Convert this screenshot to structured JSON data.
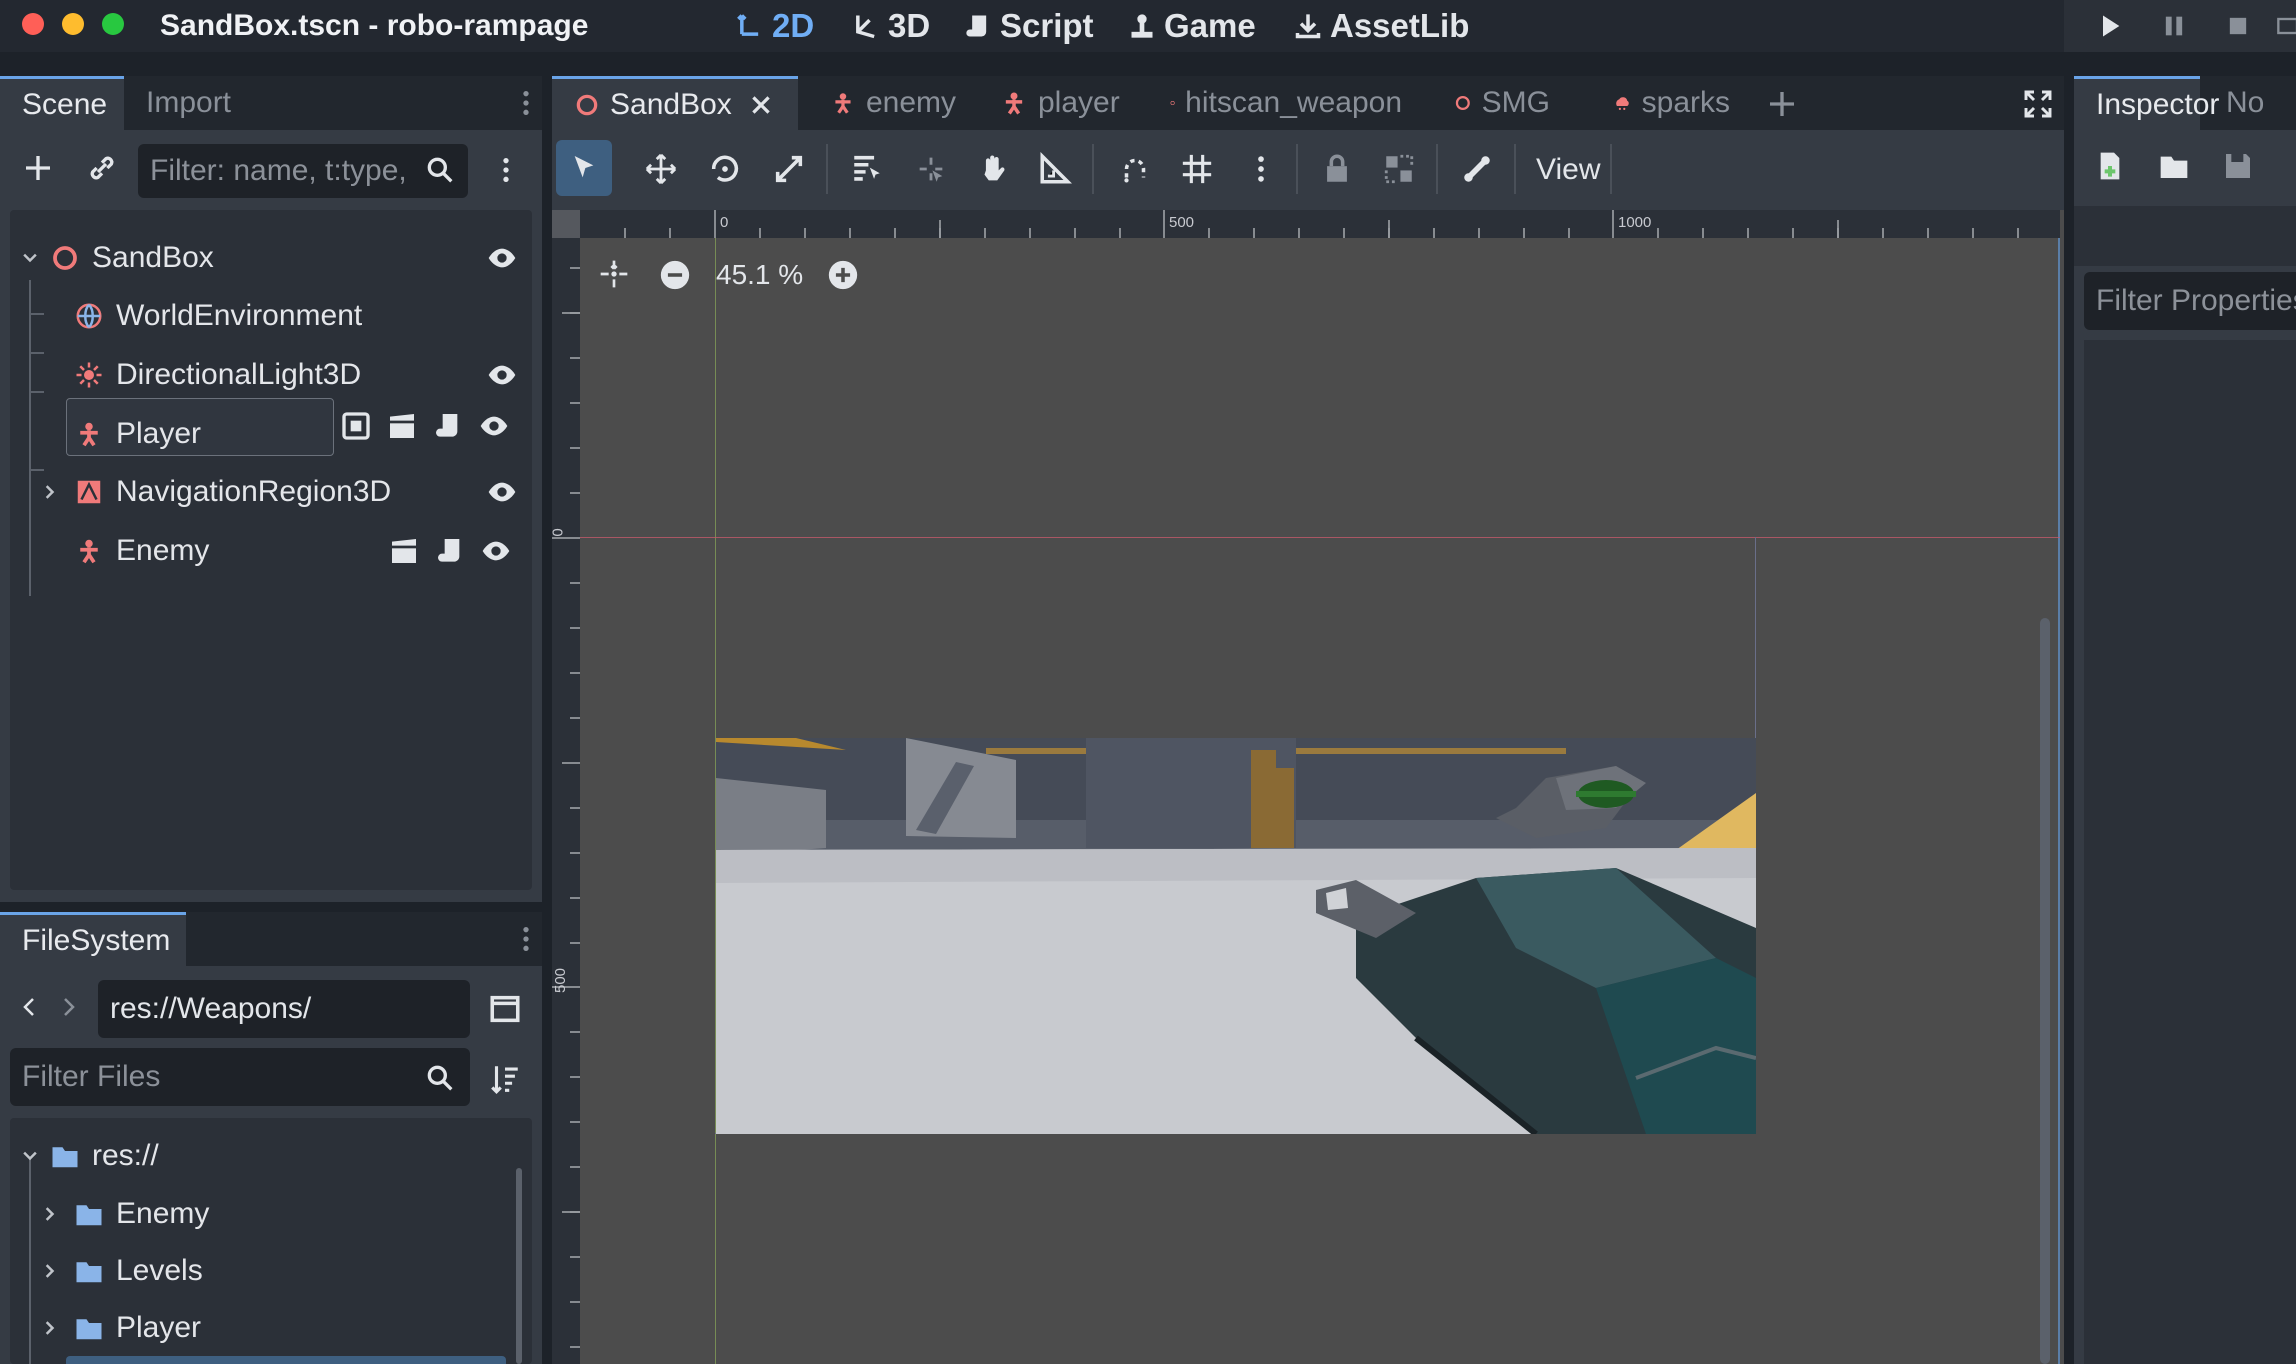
{
  "window": {
    "title": "SandBox.tscn - robo-rampage"
  },
  "workspaces": [
    {
      "label": "2D",
      "icon": "2d-icon",
      "active": true
    },
    {
      "label": "3D",
      "icon": "3d-icon",
      "active": false
    },
    {
      "label": "Script",
      "icon": "script-icon",
      "active": false
    },
    {
      "label": "Game",
      "icon": "game-icon",
      "active": false
    },
    {
      "label": "AssetLib",
      "icon": "assetlib-icon",
      "active": false
    }
  ],
  "scene_dock": {
    "tabs": [
      "Scene",
      "Import"
    ],
    "filter_placeholder": "Filter: name, t:type,",
    "nodes": [
      {
        "label": "SandBox",
        "icon": "node-icon"
      },
      {
        "label": "WorldEnvironment",
        "icon": "world-environment-icon"
      },
      {
        "label": "DirectionalLight3D",
        "icon": "light-icon"
      },
      {
        "label": "Player",
        "icon": "character-icon"
      },
      {
        "label": "NavigationRegion3D",
        "icon": "navigation-region-icon"
      },
      {
        "label": "Enemy",
        "icon": "character-icon"
      }
    ]
  },
  "filesystem_dock": {
    "tab": "FileSystem",
    "path": "res://Weapons/",
    "filter_placeholder": "Filter Files",
    "items": [
      {
        "label": "res://"
      },
      {
        "label": "Enemy"
      },
      {
        "label": "Levels"
      },
      {
        "label": "Player"
      }
    ]
  },
  "editor_tabs": [
    {
      "label": "SandBox",
      "active": true,
      "color": "#f07a7a"
    },
    {
      "label": "enemy",
      "active": false,
      "color": "#f07a7a"
    },
    {
      "label": "player",
      "active": false,
      "color": "#f07a7a"
    },
    {
      "label": "hitscan_weapon",
      "active": false,
      "color": "#f07a7a"
    },
    {
      "label": "SMG",
      "active": false,
      "color": "#f07a7a"
    },
    {
      "label": "sparks",
      "active": false,
      "color": "#f07a7a"
    }
  ],
  "toolbar": {
    "view_label": "View"
  },
  "viewport": {
    "zoom": "45.1 %",
    "ruler_top_labels": [
      "0",
      "500",
      "1000"
    ],
    "ruler_left_labels": [
      "0",
      "500"
    ]
  },
  "inspector": {
    "tabs": [
      "Inspector",
      "No"
    ],
    "filter_placeholder": "Filter Properties"
  },
  "colors": {
    "accent": "#70aef5",
    "node_red": "#f07a7a",
    "folder_blue": "#8ab4e8"
  }
}
